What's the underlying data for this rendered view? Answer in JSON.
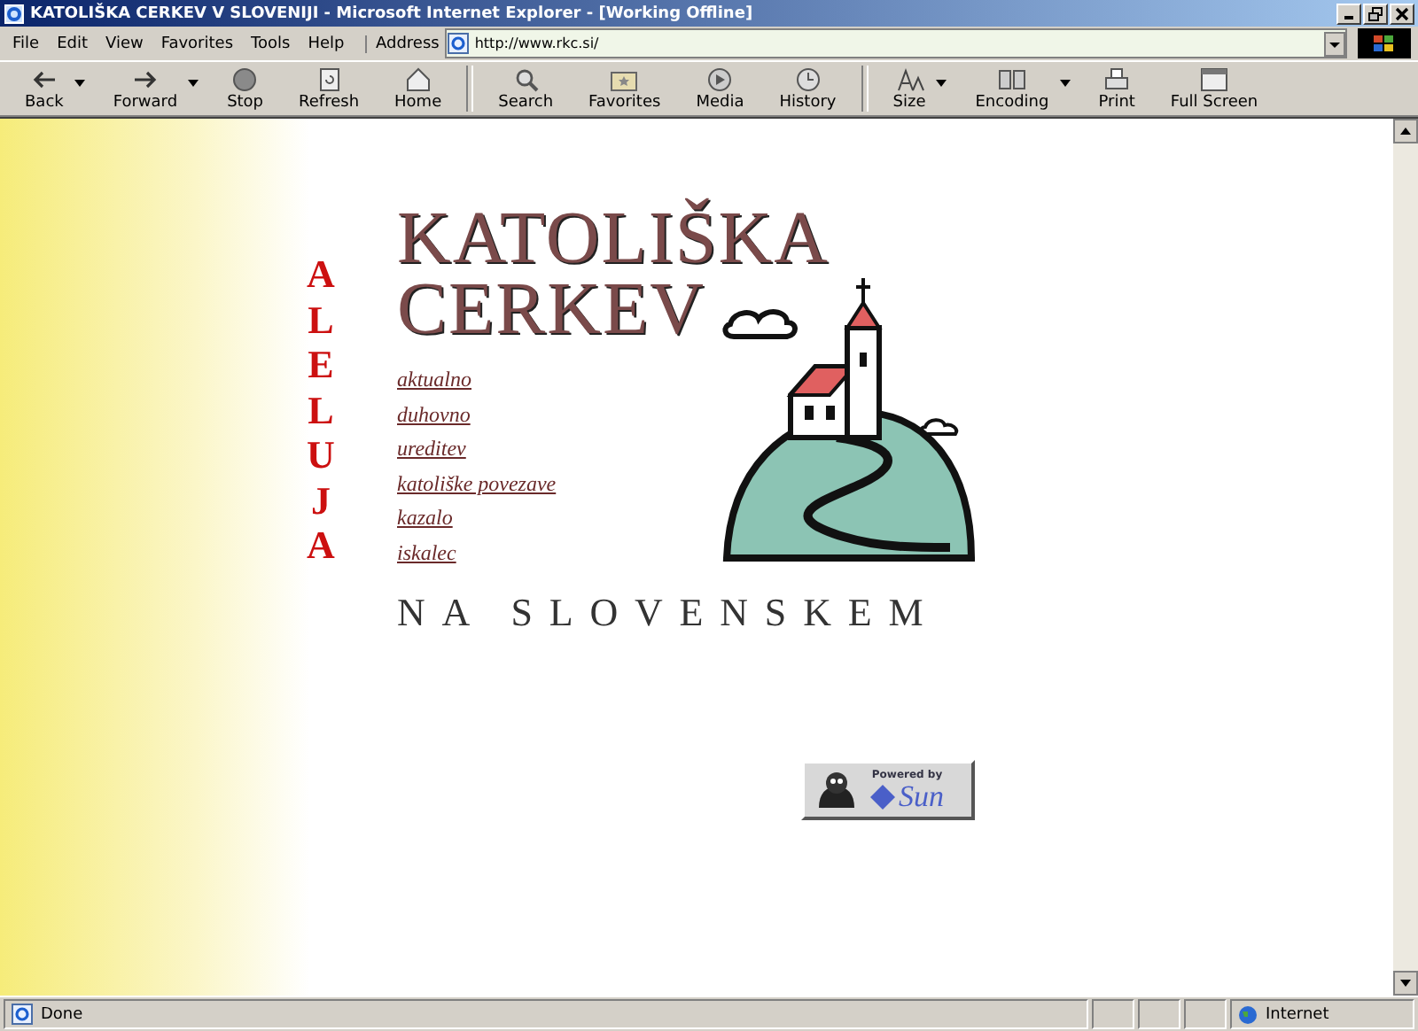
{
  "window": {
    "title": "KATOLIŠKA CERKEV V SLOVENIJI - Microsoft Internet Explorer - [Working Offline]"
  },
  "menu": [
    "File",
    "Edit",
    "View",
    "Favorites",
    "Tools",
    "Help"
  ],
  "address": {
    "label": "Address",
    "value": "http://www.rkc.si/"
  },
  "toolbar_groups": [
    [
      {
        "label": "Back",
        "has_menu": true
      },
      {
        "label": "Forward",
        "has_menu": true
      },
      {
        "label": "Stop",
        "has_menu": false
      },
      {
        "label": "Refresh",
        "has_menu": false
      },
      {
        "label": "Home",
        "has_menu": false
      }
    ],
    [
      {
        "label": "Search",
        "has_menu": false
      },
      {
        "label": "Favorites",
        "has_menu": false
      },
      {
        "label": "Media",
        "has_menu": false
      },
      {
        "label": "History",
        "has_menu": false
      }
    ],
    [
      {
        "label": "Size",
        "has_menu": true
      },
      {
        "label": "Encoding",
        "has_menu": true
      },
      {
        "label": "Print",
        "has_menu": false
      },
      {
        "label": "Full Screen",
        "has_menu": false
      }
    ]
  ],
  "page": {
    "side_word": "ALELUJA",
    "title_lines": [
      "KATOLIŠKA",
      "CERKEV"
    ],
    "links": [
      "aktualno",
      "duhovno",
      "ureditev",
      "katoliške povezave",
      "kazalo",
      "iskalec"
    ],
    "subtitle": "NA SLOVENSKEM",
    "badge": {
      "caption": "Powered by",
      "brand": "Sun"
    }
  },
  "status_bar": {
    "text": "Done",
    "zone": "Internet"
  }
}
